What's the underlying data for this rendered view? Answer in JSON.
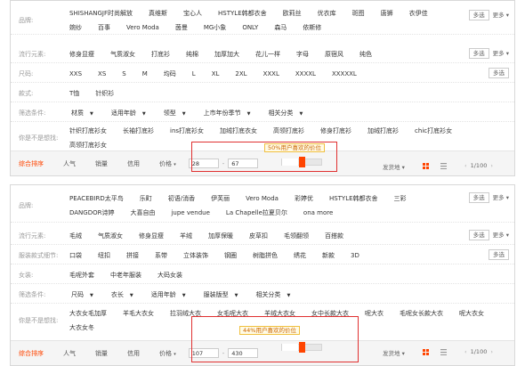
{
  "panel1": {
    "rows": [
      {
        "label": "品牌:",
        "values": [
          "SHISHANGJF时尚解放",
          "真维斯",
          "宝心人",
          "HSTYLE韩都衣舍",
          "欧莉丝",
          "优衣库",
          "斑图",
          "唐狮",
          "衣伊佳",
          "婉纱",
          "百事",
          "Vero Moda",
          "茵曼",
          "MG小象",
          "ONLY",
          "森马",
          "依斯修"
        ],
        "multi": "多选",
        "more": "更多"
      },
      {
        "label": "流行元素:",
        "values": [
          "修身显瘦",
          "气质淑女",
          "打底衫",
          "纯棉",
          "加厚加大",
          "花儿一样",
          "字母",
          "原宿风",
          "纯色"
        ],
        "multi": "多选",
        "more": "更多"
      },
      {
        "label": "尺码:",
        "values": [
          "XXS",
          "XS",
          "S",
          "M",
          "均码",
          "L",
          "XL",
          "2XL",
          "XXXL",
          "XXXXL",
          "XXXXXL"
        ],
        "multi": "多选"
      },
      {
        "label": "款式:",
        "values": [
          "T恤",
          "针织衫"
        ]
      },
      {
        "label": "筛选条件:",
        "dropdowns": [
          "材质",
          "适用年龄",
          "领型",
          "上市年份季节",
          "相关分类"
        ]
      },
      {
        "label": "你是不是想找:",
        "values": [
          "针织打底衫女",
          "长袖打底衫",
          "ins打底衫女",
          "加绒打底衣女",
          "高领打底衫",
          "修身打底衫",
          "加绒打底衫",
          "chic打底衫女",
          "高领打底衫女"
        ]
      }
    ],
    "sort": {
      "items": [
        "综合排序",
        "人气",
        "销量",
        "信用",
        "价格"
      ],
      "active": "综合排序",
      "price_arrow": "▾"
    },
    "price": {
      "min": "28",
      "max": "67",
      "tooltip": "50%用户喜欢的价位",
      "dash": "-"
    },
    "ship": "发货地",
    "pager": {
      "text": "1/100",
      "prev": "‹",
      "next": "›"
    }
  },
  "panel2": {
    "rows": [
      {
        "label": "品牌:",
        "values": [
          "PEACEBIRD太平鸟",
          "乐町",
          "初语/消香",
          "伊芙丽",
          "Vero Moda",
          "彩婷优",
          "HSTYLE韩都衣舍",
          "三彩",
          "DANGDOR诗婷",
          "大喜自由",
          "jupe vendue",
          "La Chapelle拉夏贝尔",
          "ona more"
        ],
        "multi": "多选",
        "more": "更多"
      },
      {
        "label": "流行元素:",
        "values": [
          "毛绒",
          "气质淑女",
          "修身显瘦",
          "羊绒",
          "加厚保暖",
          "皮草扣",
          "毛领翻领",
          "百搭款"
        ],
        "multi": "多选",
        "more": "更多"
      },
      {
        "label": "服装款式细节:",
        "values": [
          "口袋",
          "纽扣",
          "拼接",
          "系带",
          "立体装饰",
          "钢圈",
          "树脂拼色",
          "绣花",
          "新款",
          "3D"
        ],
        "multi": "多选"
      },
      {
        "label": "女装:",
        "values": [
          "毛呢外套",
          "中老年服装",
          "大码女装"
        ]
      },
      {
        "label": "筛选条件:",
        "dropdowns": [
          "尺码",
          "衣长",
          "适用年龄",
          "服装版型",
          "相关分类"
        ]
      },
      {
        "label": "你是不是想找:",
        "values": [
          "大衣女毛加厚",
          "羊毛大衣女",
          "拉羽绒大衣",
          "女毛呢大衣",
          "羊绒大衣女",
          "女中长款大衣",
          "呢大衣",
          "毛呢女长款大衣",
          "呢大衣女",
          "大衣女冬"
        ]
      }
    ],
    "sort": {
      "items": [
        "综合排序",
        "人气",
        "销量",
        "信用",
        "价格"
      ],
      "active": "综合排序",
      "price_arrow": "▾"
    },
    "price": {
      "min": "107",
      "max": "430",
      "tooltip": "44%用户喜欢的价位",
      "dash": "-"
    },
    "ship": "发货地",
    "pager": {
      "text": "1/100",
      "prev": "‹",
      "next": "›"
    }
  },
  "colors": {
    "accent": "#ff4400",
    "highlight_box": "#e03030"
  }
}
